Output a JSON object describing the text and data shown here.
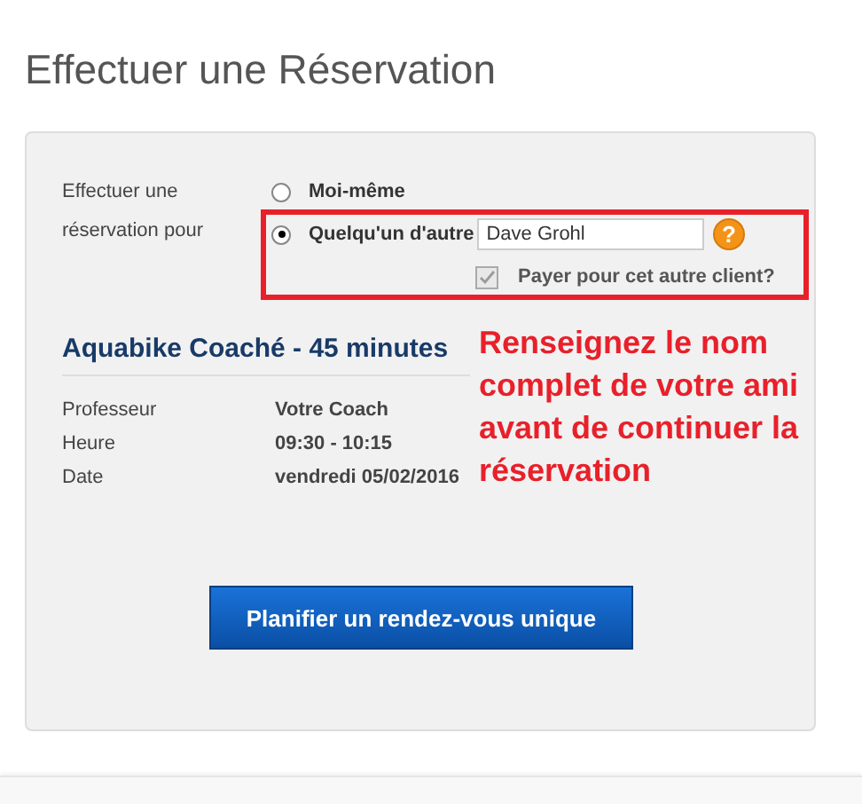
{
  "page_title": "Effectuer une Réservation",
  "booking_for": {
    "label": "Effectuer une réservation pour",
    "options": [
      {
        "label": "Moi-même",
        "selected": false
      },
      {
        "label": "Quelqu'un d'autre",
        "selected": true
      }
    ],
    "name_field": {
      "value": "Dave Grohl"
    },
    "help_icon": "?",
    "pay_checkbox": {
      "label": "Payer pour cet autre client?",
      "checked": true,
      "disabled": true
    }
  },
  "session": {
    "heading": "Aquabike Coaché - 45 minutes",
    "details": [
      {
        "label": "Professeur",
        "value": "Votre Coach"
      },
      {
        "label": "Heure",
        "value": "09:30 - 10:15"
      },
      {
        "label": "Date",
        "value": "vendredi 05/02/2016"
      }
    ]
  },
  "button": "Planifier un rendez-vous unique",
  "annotation": "Renseignez le nom complet de votre ami avant de continuer la réservation"
}
